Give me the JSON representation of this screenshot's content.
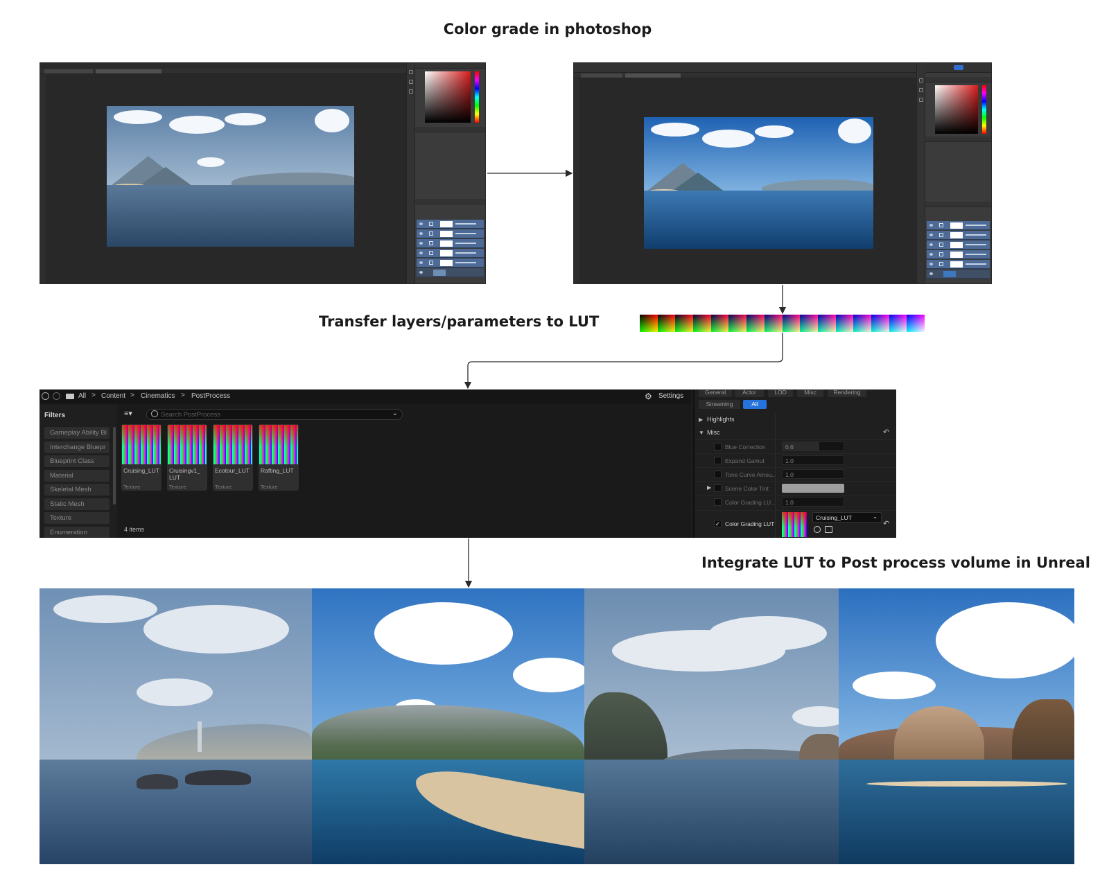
{
  "headings": {
    "step1": "Color grade in photoshop",
    "step2": "Transfer layers/parameters to LUT",
    "step3": "Integrate LUT to Post process volume in Unreal"
  },
  "colors": {
    "before_tone": "#5b7fa6",
    "after_tone": "#1f62b3",
    "unreal_accent": "#2673dd"
  },
  "icons": [
    "back-icon",
    "forward-icon",
    "folder-icon",
    "gear-icon",
    "filter-icon",
    "search-icon",
    "reset-icon",
    "browse-icon",
    "use-selected-icon",
    "eye-icon"
  ],
  "unreal": {
    "breadcrumb": {
      "all": "All",
      "content": "Content",
      "cinematics": "Cinematics",
      "postprocess": "PostProcess",
      "separator": ">"
    },
    "settings_label": "Settings",
    "filters": {
      "title": "Filters",
      "items": [
        "Gameplay Ability Bl",
        "Interchange Bluepr",
        "Blueprint Class",
        "Material",
        "Skeletal Mesh",
        "Static Mesh",
        "Texture",
        "Enumeration"
      ]
    },
    "search": {
      "placeholder": "Search PostProcess"
    },
    "assets": [
      {
        "name": "Cruising_LUT",
        "type": "Texture"
      },
      {
        "name": "Cruisingv1_ LUT",
        "type": "Texture"
      },
      {
        "name": "Ecotour_LUT",
        "type": "Texture"
      },
      {
        "name": "Rafting_LUT",
        "type": "Texture"
      }
    ],
    "item_count": "4 items",
    "details": {
      "tabs": [
        "General",
        "Actor",
        "LOD",
        "Misc",
        "Rendering"
      ],
      "tabs2": [
        "Streaming",
        "All"
      ],
      "sections": {
        "highlights": "Highlights",
        "misc": "Misc"
      },
      "properties": [
        {
          "name": "Blue Correction",
          "value": "0.6",
          "fill": 0.6
        },
        {
          "name": "Expand Gamut",
          "value": "1.0"
        },
        {
          "name": "Tone Curve Amou...",
          "value": "1.0"
        },
        {
          "name": "Scene Color Tint",
          "value": ""
        },
        {
          "name": "Color Grading LU...",
          "value": "1.0"
        }
      ],
      "lut_property": {
        "name": "Color Grading LUT",
        "selected": "Cruising_LUT",
        "checked": "✓"
      }
    }
  }
}
